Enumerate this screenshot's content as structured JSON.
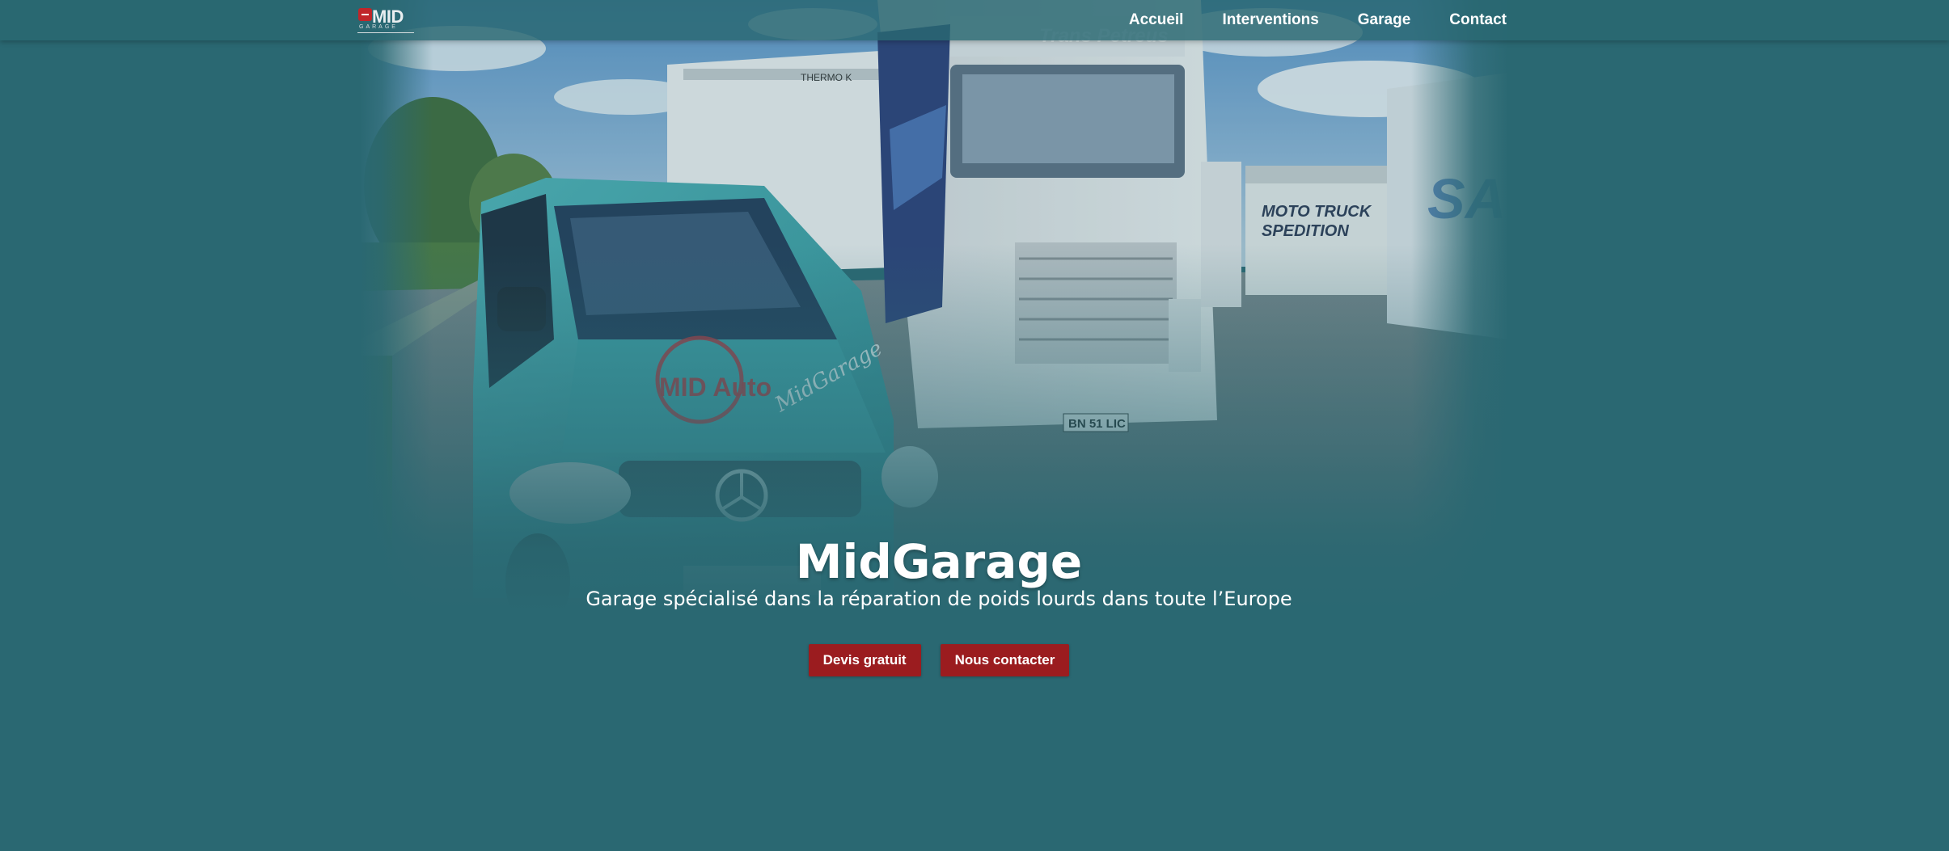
{
  "brand": {
    "logo_text": "MID",
    "logo_subtext": "GARAGE"
  },
  "nav": {
    "items": [
      {
        "label": "Accueil"
      },
      {
        "label": "Interventions"
      },
      {
        "label": "Garage"
      },
      {
        "label": "Contact"
      }
    ]
  },
  "hero": {
    "title": "MidGarage",
    "subtitle": "Garage spécialisé dans la réparation de poids lourds dans toute l’Europe",
    "photo_texts": {
      "van_logo": "MID Auto",
      "van_script": "MidGarage",
      "truck_brand": "Trans Petreus",
      "truck_plate": "BN 51 LIC",
      "trailer_text": "THERMO K",
      "depot_text_1": "MOTO TRUCK",
      "depot_text_2": "SPEDITION",
      "trailer_right": "SA"
    },
    "buttons": [
      {
        "label": "Devis gratuit"
      },
      {
        "label": "Nous contacter"
      }
    ]
  },
  "colors": {
    "background": "#2a6872",
    "button": "#9b1c1f",
    "text": "#ffffff",
    "logo_red": "#c0262a"
  }
}
